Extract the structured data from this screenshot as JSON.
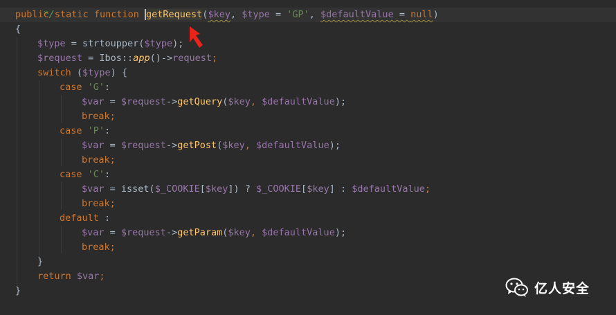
{
  "code": {
    "comment_end": "*/",
    "line1": {
      "kw_public": "public",
      "kw_static": "static",
      "kw_function": "function",
      "fn_name": "getRequest",
      "open_paren": "(",
      "p_key": "$key",
      "comma1": ", ",
      "p_type": "$type",
      "eq1": " = ",
      "str_gp": "'GP'",
      "comma2": ", ",
      "p_default": "$defaultValue",
      "eq2": " = ",
      "kw_null": "null",
      "close_paren": ")"
    },
    "brace_open": "{",
    "line3": {
      "var": "$type",
      "eq": " = ",
      "fn": "strtoupper(",
      "arg": "$type",
      "end": ");"
    },
    "line4": {
      "var": "$request",
      "eq": " = Ibos::",
      "fn": "app",
      "mid": "()->",
      "prop": "request",
      "end": ";"
    },
    "line5": {
      "kw": "switch",
      "open": " (",
      "var": "$type",
      "close": ") {"
    },
    "case_g": {
      "kw": "case",
      "str": "'G'",
      "colon": ":"
    },
    "case_g_body": {
      "var": "$var",
      "eq": " = ",
      "obj": "$request",
      "arrow": "->",
      "method": "getQuery",
      "open": "(",
      "a1": "$key",
      "sep": ", ",
      "a2": "$defaultValue",
      "end": ");"
    },
    "break": "break",
    "semi": ";",
    "case_p": {
      "kw": "case",
      "str": "'P'",
      "colon": ":"
    },
    "case_p_body": {
      "var": "$var",
      "eq": " = ",
      "obj": "$request",
      "arrow": "->",
      "method": "getPost",
      "open": "(",
      "a1": "$key",
      "sep": ", ",
      "a2": "$defaultValue",
      "end": ");"
    },
    "case_c": {
      "kw": "case",
      "str": "'C'",
      "colon": ":"
    },
    "case_c_body": {
      "var": "$var",
      "eq": " = ",
      "isset": "isset(",
      "cookie1": "$_COOKIE",
      "b1": "[",
      "k1": "$key",
      "b2": "]) ? ",
      "cookie2": "$_COOKIE",
      "b3": "[",
      "k2": "$key",
      "b4": "] : ",
      "dv": "$defaultValue",
      "end": ";"
    },
    "default_case": {
      "kw": "default",
      "colon": " :"
    },
    "default_body": {
      "var": "$var",
      "eq": " = ",
      "obj": "$request",
      "arrow": "->",
      "method": "getParam",
      "open": "(",
      "a1": "$key",
      "sep": ", ",
      "a2": "$defaultValue",
      "end": ");"
    },
    "switch_close": "}",
    "return_line": {
      "kw": "return",
      "var": "$var",
      "end": ";"
    },
    "brace_close": "}"
  },
  "watermark": {
    "text": "亿人安全",
    "icon": "wechat-icon"
  },
  "colors": {
    "background": "#2b2b2b",
    "keyword": "#cc7832",
    "function": "#ffc66d",
    "variable": "#9876aa",
    "string": "#6a8759",
    "text": "#a9b7c6",
    "arrow": "#e8231a"
  }
}
